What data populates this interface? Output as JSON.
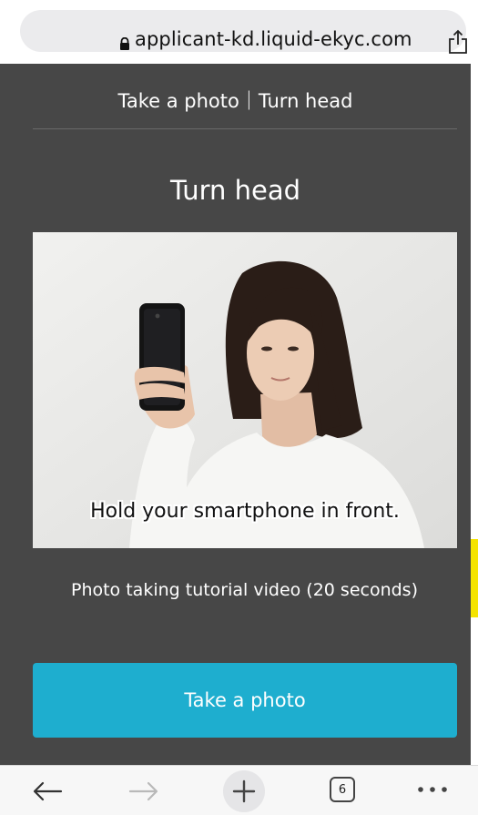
{
  "browser": {
    "url": "applicant-kd.liquid-ekyc.com",
    "tab_count": "6"
  },
  "page": {
    "header": "Take a photo｜Turn head",
    "title": "Turn head",
    "video_caption": "Hold your smartphone in front.",
    "video_description": "Photo taking tutorial video (20 seconds)",
    "take_photo_button": "Take a photo"
  },
  "colors": {
    "page_background": "#474747",
    "button": "#1eaecf",
    "side_bar": "#f5e400"
  },
  "icons": [
    "lock-icon",
    "share-icon",
    "back-arrow-icon",
    "forward-arrow-icon",
    "new-tab-plus-icon",
    "tabs-count-icon",
    "more-menu-icon"
  ]
}
